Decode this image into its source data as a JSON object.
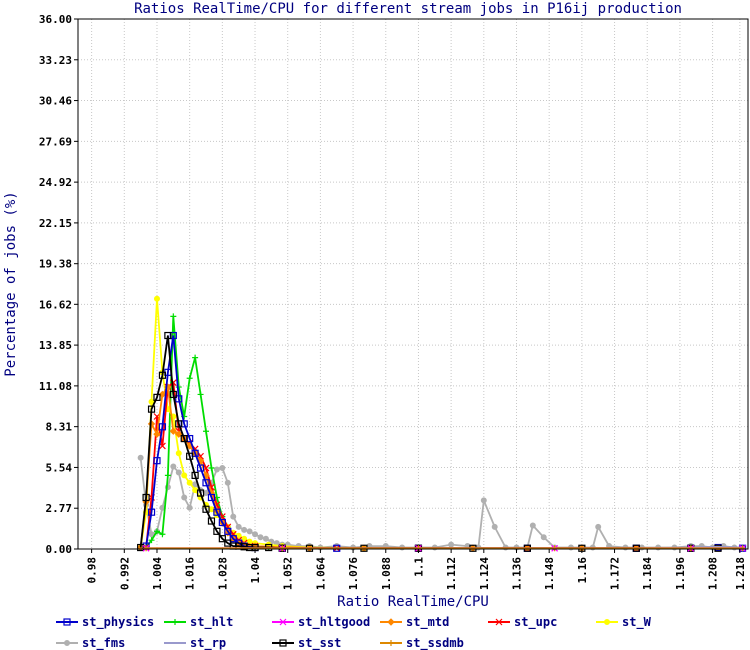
{
  "chart_data": {
    "type": "line",
    "title": "Ratios RealTime/CPU for different stream jobs in P16ij production",
    "xlabel": "Ratio RealTime/CPU",
    "ylabel": "Percentage of jobs (%)",
    "xlim": [
      0.975,
      1.221
    ],
    "ylim": [
      0,
      36
    ],
    "xticks": [
      "0.98",
      "0.992",
      "1.004",
      "1.016",
      "1.028",
      "1.04",
      "1.052",
      "1.064",
      "1.076",
      "1.088",
      "1.1",
      "1.112",
      "1.124",
      "1.136",
      "1.148",
      "1.16",
      "1.172",
      "1.184",
      "1.196",
      "1.208",
      "1.218"
    ],
    "yticks": [
      "0.00",
      "2.77",
      "5.54",
      "8.31",
      "11.08",
      "13.85",
      "16.62",
      "19.38",
      "22.15",
      "24.92",
      "27.69",
      "30.46",
      "33.23",
      "36.00"
    ],
    "grid": true,
    "legend_position": "bottom",
    "series": [
      {
        "name": "st_fms",
        "color": "#b0b0b0",
        "marker": "circle",
        "x": [
          0.998,
          1.0,
          1.002,
          1.004,
          1.006,
          1.008,
          1.01,
          1.012,
          1.014,
          1.016,
          1.018,
          1.02,
          1.022,
          1.024,
          1.026,
          1.028,
          1.03,
          1.032,
          1.034,
          1.036,
          1.038,
          1.04,
          1.042,
          1.044,
          1.046,
          1.048,
          1.05,
          1.052,
          1.056,
          1.06,
          1.064,
          1.07,
          1.076,
          1.082,
          1.088,
          1.094,
          1.1,
          1.106,
          1.112,
          1.118,
          1.122,
          1.124,
          1.128,
          1.132,
          1.136,
          1.14,
          1.142,
          1.146,
          1.15,
          1.156,
          1.16,
          1.164,
          1.166,
          1.17,
          1.176,
          1.182,
          1.188,
          1.194,
          1.2,
          1.204,
          1.208,
          1.212,
          1.216,
          1.219
        ],
        "y": [
          6.2,
          3.0,
          1.0,
          1.2,
          2.8,
          4.2,
          5.6,
          5.2,
          3.5,
          2.8,
          4.4,
          4.0,
          3.8,
          4.5,
          5.4,
          5.5,
          4.5,
          2.2,
          1.5,
          1.3,
          1.2,
          1.0,
          0.8,
          0.7,
          0.5,
          0.4,
          0.3,
          0.3,
          0.2,
          0.2,
          0.1,
          0.2,
          0.1,
          0.2,
          0.2,
          0.1,
          0.1,
          0.1,
          0.3,
          0.2,
          0.1,
          3.3,
          1.5,
          0.1,
          0.1,
          0.1,
          1.6,
          0.8,
          0.1,
          0.1,
          0.1,
          0.1,
          1.5,
          0.2,
          0.1,
          0.1,
          0.1,
          0.1,
          0.2,
          0.2,
          0.1,
          0.2,
          0.1,
          0.1
        ]
      },
      {
        "name": "st_hlt",
        "color": "#00dd00",
        "marker": "plus",
        "x": [
          1.0,
          1.002,
          1.004,
          1.006,
          1.008,
          1.01,
          1.012,
          1.014,
          1.016,
          1.018,
          1.02,
          1.022,
          1.024,
          1.026,
          1.028,
          1.03,
          1.032,
          1.034,
          1.036,
          1.038,
          1.04,
          1.045,
          1.05,
          1.06,
          1.08,
          1.1,
          1.12,
          1.14,
          1.16,
          1.18,
          1.2,
          1.21
        ],
        "y": [
          0.1,
          0.6,
          1.2,
          1.0,
          5.0,
          15.8,
          11.0,
          9.0,
          11.6,
          13.0,
          10.5,
          8.0,
          5.5,
          3.5,
          2.2,
          1.5,
          0.8,
          0.4,
          0.3,
          0.2,
          0.1,
          0.1,
          0.05,
          0.05,
          0.05,
          0.05,
          0.05,
          0.05,
          0.05,
          0.05,
          0.05,
          0.05
        ]
      },
      {
        "name": "st_W",
        "color": "#ffff00",
        "marker": "circle",
        "x": [
          0.998,
          1.0,
          1.002,
          1.004,
          1.006,
          1.008,
          1.01,
          1.012,
          1.014,
          1.016,
          1.018,
          1.02,
          1.022,
          1.024,
          1.026,
          1.028,
          1.03,
          1.032,
          1.034,
          1.036,
          1.038,
          1.04,
          1.045,
          1.05,
          1.06,
          1.08,
          1.1
        ],
        "y": [
          0.1,
          2.5,
          10.0,
          17.0,
          12.0,
          9.5,
          9.0,
          6.5,
          5.0,
          4.5,
          4.0,
          3.5,
          3.0,
          2.7,
          2.3,
          1.9,
          1.5,
          1.1,
          0.9,
          0.7,
          0.5,
          0.4,
          0.3,
          0.2,
          0.1,
          0.05,
          0.05
        ]
      },
      {
        "name": "st_upc",
        "color": "#ff0000",
        "marker": "cross",
        "x": [
          1.0,
          1.002,
          1.004,
          1.006,
          1.008,
          1.01,
          1.012,
          1.014,
          1.016,
          1.018,
          1.02,
          1.022,
          1.024,
          1.026,
          1.028,
          1.03,
          1.032,
          1.034,
          1.036,
          1.04,
          1.05,
          1.07,
          1.1,
          1.14,
          1.18,
          1.2,
          1.21
        ],
        "y": [
          0.1,
          3.5,
          9.0,
          7.0,
          11.0,
          11.3,
          8.0,
          7.5,
          7.2,
          6.8,
          6.3,
          5.5,
          4.2,
          3.0,
          2.2,
          1.5,
          1.0,
          0.6,
          0.4,
          0.2,
          0.1,
          0.05,
          0.05,
          0.05,
          0.05,
          0.05,
          0.05
        ]
      },
      {
        "name": "st_mtd",
        "color": "#ff8800",
        "marker": "diamond",
        "x": [
          0.998,
          1.0,
          1.002,
          1.004,
          1.006,
          1.008,
          1.01,
          1.012,
          1.014,
          1.016,
          1.018,
          1.02,
          1.022,
          1.024,
          1.026,
          1.028,
          1.03,
          1.032,
          1.034,
          1.036,
          1.04,
          1.05,
          1.06,
          1.08,
          1.1,
          1.12,
          1.14,
          1.16,
          1.18,
          1.2,
          1.21
        ],
        "y": [
          0.1,
          3.2,
          8.5,
          7.8,
          10.5,
          11.0,
          8.0,
          7.8,
          7.5,
          7.0,
          6.5,
          6.0,
          5.0,
          3.8,
          2.6,
          1.8,
          1.1,
          0.7,
          0.4,
          0.3,
          0.2,
          0.1,
          0.05,
          0.05,
          0.05,
          0.05,
          0.05,
          0.05,
          0.05,
          0.05,
          0.05
        ]
      },
      {
        "name": "st_physics",
        "color": "#0000cc",
        "marker": "square",
        "x": [
          1.0,
          1.002,
          1.004,
          1.006,
          1.008,
          1.01,
          1.012,
          1.014,
          1.016,
          1.018,
          1.02,
          1.022,
          1.024,
          1.026,
          1.028,
          1.03,
          1.032,
          1.034,
          1.036,
          1.04,
          1.05,
          1.07,
          1.1,
          1.14,
          1.18,
          1.2,
          1.21,
          1.219
        ],
        "y": [
          0.2,
          2.5,
          6.0,
          8.3,
          12.0,
          14.5,
          10.2,
          8.5,
          7.5,
          6.5,
          5.5,
          4.5,
          3.5,
          2.5,
          1.8,
          1.2,
          0.7,
          0.4,
          0.2,
          0.1,
          0.05,
          0.05,
          0.05,
          0.05,
          0.05,
          0.05,
          0.1,
          0.05
        ]
      },
      {
        "name": "st_sst",
        "color": "#000000",
        "marker": "square",
        "x": [
          0.998,
          1.0,
          1.002,
          1.004,
          1.006,
          1.008,
          1.01,
          1.012,
          1.014,
          1.016,
          1.018,
          1.02,
          1.022,
          1.024,
          1.026,
          1.028,
          1.03,
          1.032,
          1.034,
          1.036,
          1.038,
          1.04,
          1.045,
          1.05,
          1.06,
          1.08,
          1.1,
          1.12,
          1.14,
          1.16,
          1.18,
          1.2,
          1.21
        ],
        "y": [
          0.1,
          3.5,
          9.5,
          10.3,
          11.8,
          14.5,
          10.5,
          8.5,
          7.5,
          6.3,
          5.0,
          3.8,
          2.7,
          1.9,
          1.2,
          0.7,
          0.4,
          0.2,
          0.2,
          0.15,
          0.1,
          0.1,
          0.1,
          0.05,
          0.05,
          0.05,
          0.05,
          0.05,
          0.05,
          0.05,
          0.05,
          0.05,
          0.05
        ]
      },
      {
        "name": "st_rp",
        "color": "#9999cc",
        "marker": "none",
        "x": [
          1.0,
          1.01,
          1.02,
          1.04,
          1.06,
          1.08,
          1.1,
          1.12,
          1.14,
          1.16,
          1.18,
          1.2,
          1.21,
          1.219
        ],
        "y": [
          0.05,
          0.05,
          0.05,
          0.05,
          0.05,
          0.05,
          0.05,
          0.05,
          0.05,
          0.05,
          0.05,
          0.1,
          0.15,
          0.1
        ]
      },
      {
        "name": "st_hltgood",
        "color": "#ff00ff",
        "marker": "cross",
        "x": [
          1.0,
          1.05,
          1.1,
          1.15,
          1.2,
          1.219
        ],
        "y": [
          0.05,
          0.05,
          0.05,
          0.05,
          0.05,
          0.05
        ]
      },
      {
        "name": "st_ssdmb",
        "color": "#dd8800",
        "marker": "plus",
        "x": [
          1.0,
          1.05,
          1.1,
          1.15,
          1.2,
          1.219
        ],
        "y": [
          0.05,
          0.05,
          0.05,
          0.05,
          0.05,
          0.05
        ]
      }
    ],
    "legend": [
      {
        "name": "st_physics",
        "color": "#0000cc",
        "marker": "square"
      },
      {
        "name": "st_hlt",
        "color": "#00dd00",
        "marker": "plus"
      },
      {
        "name": "st_hltgood",
        "color": "#ff00ff",
        "marker": "cross"
      },
      {
        "name": "st_mtd",
        "color": "#ff8800",
        "marker": "diamond"
      },
      {
        "name": "st_upc",
        "color": "#ff0000",
        "marker": "cross"
      },
      {
        "name": "st_W",
        "color": "#ffff00",
        "marker": "circle"
      },
      {
        "name": "st_fms",
        "color": "#b0b0b0",
        "marker": "circle"
      },
      {
        "name": "st_rp",
        "color": "#9999cc",
        "marker": "none"
      },
      {
        "name": "st_sst",
        "color": "#000000",
        "marker": "square"
      },
      {
        "name": "st_ssdmb",
        "color": "#dd8800",
        "marker": "plus"
      }
    ]
  }
}
